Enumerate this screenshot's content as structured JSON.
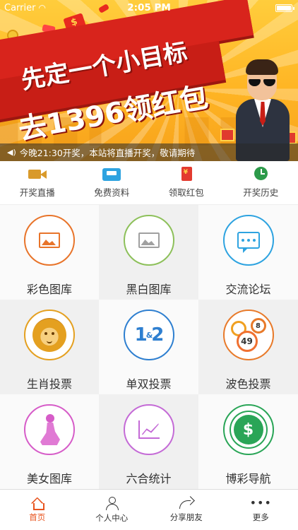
{
  "status_bar": {
    "carrier": "Carrier",
    "time": "2:05 PM"
  },
  "banner": {
    "slogan_line1": "先定一个小目标",
    "slogan_line2": "去1396领红包",
    "notice": "今晚21:30开奖，本站将直播开奖，敬请期待"
  },
  "quick_menu": [
    {
      "label": "开奖直播",
      "icon": "video-camera-icon"
    },
    {
      "label": "免费资料",
      "icon": "inbox-icon"
    },
    {
      "label": "领取红包",
      "icon": "red-envelope-icon"
    },
    {
      "label": "开奖历史",
      "icon": "clock-icon"
    }
  ],
  "grid": [
    {
      "label": "彩色图库",
      "icon": "color-image-icon",
      "color": "#e8742a"
    },
    {
      "label": "黑白图库",
      "icon": "bw-image-icon",
      "color": "#8dc05a"
    },
    {
      "label": "交流论坛",
      "icon": "chat-icon",
      "color": "#2ea3e0"
    },
    {
      "label": "生肖投票",
      "icon": "zodiac-lion-icon",
      "color": "#e4a020"
    },
    {
      "label": "单双投票",
      "icon": "odd-even-icon",
      "color": "#2e7fd0"
    },
    {
      "label": "波色投票",
      "icon": "lottery-balls-icon",
      "color": "#e87a2a",
      "balls": [
        "",
        "8",
        "49"
      ]
    },
    {
      "label": "美女图库",
      "icon": "girl-icon",
      "color": "#d65cc8"
    },
    {
      "label": "六合统计",
      "icon": "statistics-icon",
      "color": "#c46ad6"
    },
    {
      "label": "博彩导航",
      "icon": "dollar-coin-icon",
      "color": "#2aa557"
    }
  ],
  "grid_odd_even_glyph": {
    "one": "1",
    "amp": "&",
    "two": "2"
  },
  "grid_dollar_glyph": "$",
  "tabbar": [
    {
      "label": "首页",
      "icon": "home-icon",
      "active": true
    },
    {
      "label": "个人中心",
      "icon": "user-icon",
      "active": false
    },
    {
      "label": "分享朋友",
      "icon": "share-icon",
      "active": false
    },
    {
      "label": "更多",
      "icon": "more-icon",
      "active": false
    }
  ],
  "tab_more_glyph": "•••",
  "colors": {
    "accent": "#e8541e",
    "banner_red": "#d8241c",
    "banner_yellow": "#ffb524"
  }
}
